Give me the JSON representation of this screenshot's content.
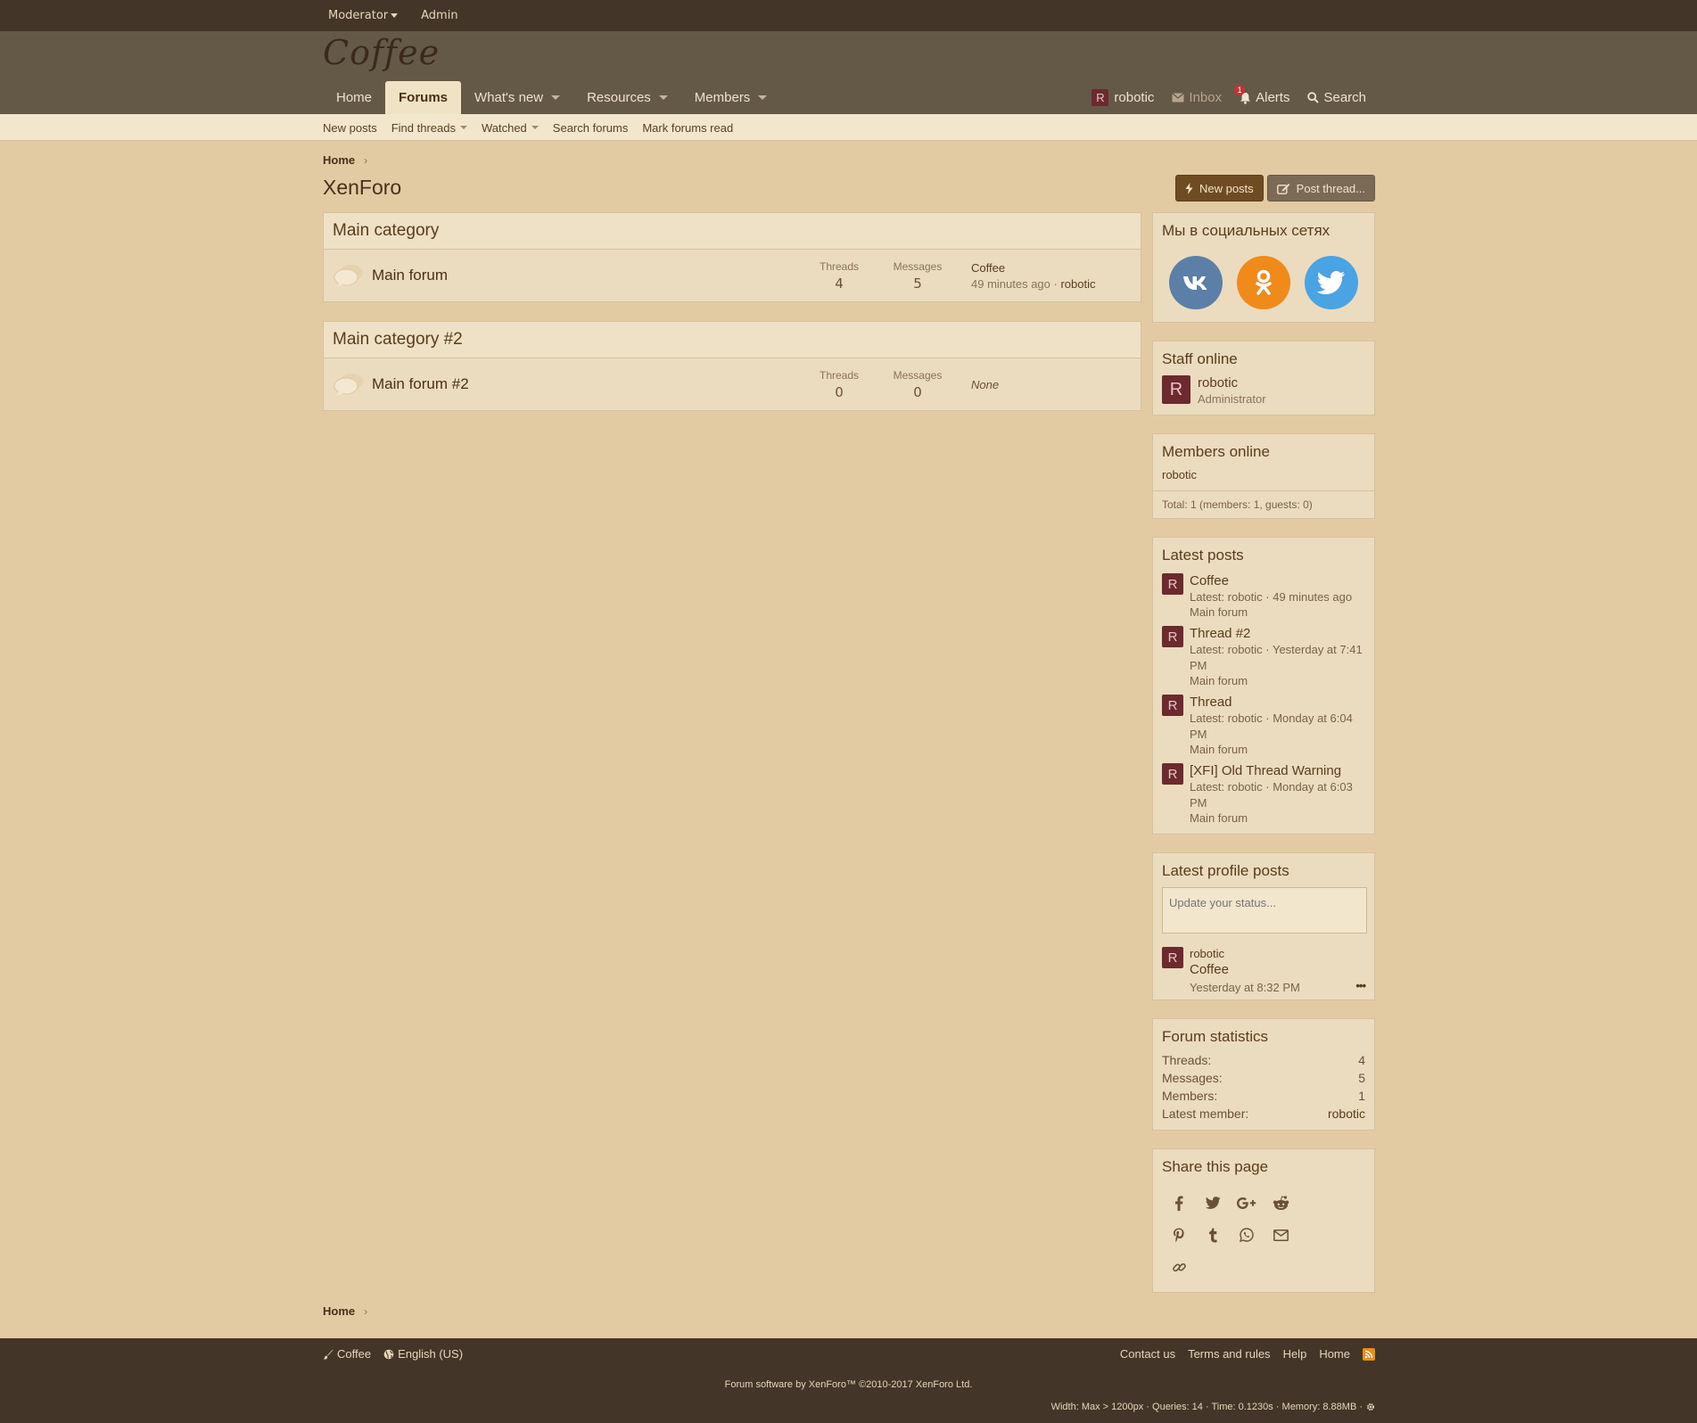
{
  "staffbar": {
    "moderator": "Moderator",
    "admin": "Admin"
  },
  "header": {
    "logo": "Coffee"
  },
  "nav": {
    "tabs": [
      {
        "label": "Home"
      },
      {
        "label": "Forums"
      },
      {
        "label": "What's new"
      },
      {
        "label": "Resources"
      },
      {
        "label": "Members"
      }
    ],
    "user": {
      "avatar_letter": "R",
      "name": "robotic"
    },
    "inbox": "Inbox",
    "alerts": "Alerts",
    "alerts_count": "1",
    "search": "Search"
  },
  "subnav": [
    "New posts",
    "Find threads",
    "Watched",
    "Search forums",
    "Mark forums read"
  ],
  "breadcrumb": "Home",
  "page": {
    "title": "XenForo",
    "new_posts_btn": "New posts",
    "post_thread_btn": "Post thread..."
  },
  "categories": [
    {
      "title": "Main category",
      "forum": {
        "title": "Main forum",
        "threads_label": "Threads",
        "threads": "4",
        "messages_label": "Messages",
        "messages": "5",
        "last_title": "Coffee",
        "last_time": "49 minutes ago",
        "last_user": "robotic"
      }
    },
    {
      "title": "Main category #2",
      "forum": {
        "title": "Main forum #2",
        "threads_label": "Threads",
        "threads": "0",
        "messages_label": "Messages",
        "messages": "0",
        "last_none": "None"
      }
    }
  ],
  "sidebar": {
    "social_title": "Мы в социальных сетях",
    "social_icons": [
      "vk-icon",
      "odnoklassniki-icon",
      "twitter-icon"
    ],
    "staff": {
      "title": "Staff online",
      "avatar_letter": "R",
      "name": "robotic",
      "role": "Administrator"
    },
    "members_online": {
      "title": "Members online",
      "list": "robotic",
      "total": "Total: 1 (members: 1, guests: 0)"
    },
    "latest_posts": {
      "title": "Latest posts",
      "items": [
        {
          "letter": "R",
          "title": "Coffee",
          "meta": "Latest: robotic · 49 minutes ago",
          "forum": "Main forum"
        },
        {
          "letter": "R",
          "title": "Thread #2",
          "meta": "Latest: robotic · Yesterday at 7:41 PM",
          "forum": "Main forum"
        },
        {
          "letter": "R",
          "title": "Thread",
          "meta": "Latest: robotic · Monday at 6:04 PM",
          "forum": "Main forum"
        },
        {
          "letter": "R",
          "title": "[XFI] Old Thread Warning",
          "meta": "Latest: robotic · Monday at 6:03 PM",
          "forum": "Main forum"
        }
      ]
    },
    "profile_posts": {
      "title": "Latest profile posts",
      "placeholder": "Update your status...",
      "post": {
        "letter": "R",
        "name": "robotic",
        "text": "Coffee",
        "date": "Yesterday at 8:32 PM",
        "more": "•••"
      }
    },
    "forum_stats": {
      "title": "Forum statistics",
      "rows": [
        {
          "label": "Threads:",
          "value": "4"
        },
        {
          "label": "Messages:",
          "value": "5"
        },
        {
          "label": "Members:",
          "value": "1"
        },
        {
          "label": "Latest member:",
          "value": "robotic"
        }
      ]
    },
    "share": {
      "title": "Share this page",
      "icons": [
        "facebook-icon",
        "twitter-icon",
        "google-plus-icon",
        "reddit-icon",
        "pinterest-icon",
        "tumblr-icon",
        "whatsapp-icon",
        "email-icon",
        "link-icon"
      ]
    }
  },
  "footer": {
    "style": "Coffee",
    "language": "English (US)",
    "links": [
      "Contact us",
      "Terms and rules",
      "Help",
      "Home"
    ],
    "copyright": "Forum software by XenForo™ ©2010-2017 XenForo Ltd.",
    "debug": "Width: Max > 1200px · Queries: 14 · Time: 0.1230s · Memory: 8.88MB ·"
  },
  "colors": {
    "vk": "#5b7fa6",
    "ok": "#f08a1b",
    "twitter": "#4aa3e2",
    "page_bg": "#e2caa2",
    "header_bg": "#645846",
    "staffbar_bg": "#433629"
  }
}
